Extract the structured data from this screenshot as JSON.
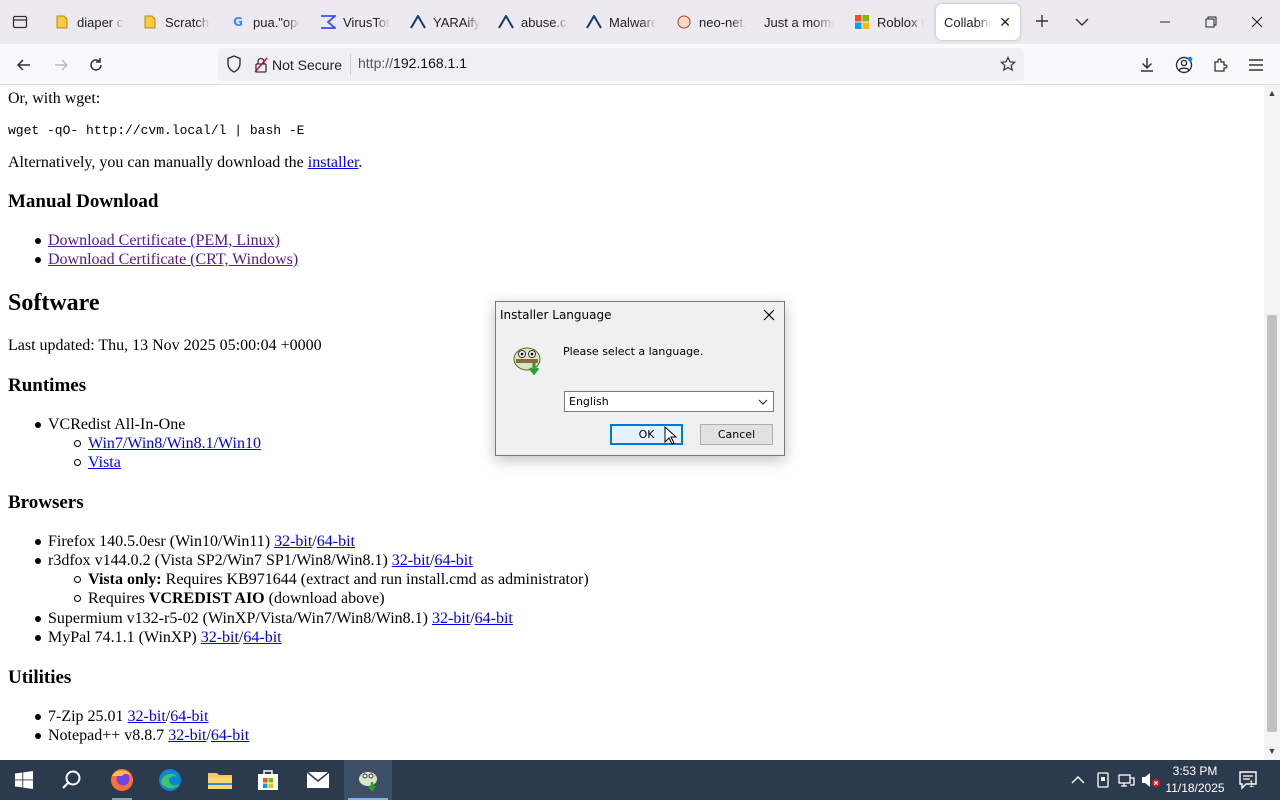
{
  "browser": {
    "tabs": [
      {
        "label": "diaper cl",
        "icon": "document-icon",
        "active": false
      },
      {
        "label": "Scratch -",
        "icon": "document-icon",
        "active": false
      },
      {
        "label": "pua.\"opc",
        "icon": "google-icon",
        "active": false
      },
      {
        "label": "VirusTota",
        "icon": "virustotal-icon",
        "active": false
      },
      {
        "label": "YARAify",
        "icon": "yaraify-icon",
        "active": false
      },
      {
        "label": "abuse.ch",
        "icon": "abusech-icon",
        "active": false
      },
      {
        "label": "Malware",
        "icon": "malware-icon",
        "active": false
      },
      {
        "label": "neo-net.",
        "icon": "web-icon",
        "active": false
      },
      {
        "label": "Just a mome",
        "icon": "loading-icon",
        "active": false
      },
      {
        "label": "Roblox U",
        "icon": "microsoft-icon",
        "active": false
      },
      {
        "label": "Collabnet",
        "icon": "none",
        "active": true
      }
    ],
    "security_label": "Not Secure",
    "url_prefix": "http://",
    "url_host": "192.168.1.1"
  },
  "page": {
    "wget_intro": "Or, with wget:",
    "wget_command": "wget -qO- http://cvm.local/l | bash -E",
    "alt_text_before": "Alternatively, you can manually download the ",
    "alt_link": "installer",
    "alt_text_after": ".",
    "manual_heading": "Manual Download",
    "cert_pem": "Download Certificate (PEM, Linux)",
    "cert_crt": "Download Certificate (CRT, Windows)",
    "software_heading": "Software",
    "last_updated": "Last updated: Thu, 13 Nov 2025 05:00:04 +0000",
    "runtimes_heading": "Runtimes",
    "vcredist_label": "VCRedist All-In-One",
    "vcredist_win": "Win7/Win8/Win8.1/Win10",
    "vcredist_vista": "Vista",
    "browsers_heading": "Browsers",
    "firefox_label": "Firefox 140.5.0esr (Win10/Win11) ",
    "r3dfox_label": "r3dfox v144.0.2 (Vista SP2/Win7 SP1/Win8/Win8.1) ",
    "vista_only_bold": "Vista only:",
    "vista_only_text": " Requires KB971644 (extract and run install.cmd as administrator)",
    "requires_text": "Requires ",
    "requires_bold": "VCREDIST AIO",
    "requires_after": " (download above)",
    "supermium_label": "Supermium v132-r5-02 (WinXP/Vista/Win7/Win8/Win8.1) ",
    "mypal_label": "MyPal 74.1.1 (WinXP) ",
    "utilities_heading": "Utilities",
    "sevenzip_label": "7-Zip 25.01 ",
    "notepad_label": "Notepad++ v8.8.7 ",
    "link_32": "32-bit",
    "link_sep": "/",
    "link_64": "64-bit"
  },
  "dialog": {
    "title": "Installer Language",
    "message": "Please select a language.",
    "selected_language": "English",
    "ok_label": "OK",
    "cancel_label": "Cancel"
  },
  "taskbar": {
    "time": "3:53 PM",
    "date": "11/18/2025",
    "notification_count": "1"
  },
  "colors": {
    "link": "#0000ee",
    "visited_link": "#551a8b",
    "taskbar_bg": "#2b3a4d",
    "dialog_ok_border": "#0078d7"
  }
}
